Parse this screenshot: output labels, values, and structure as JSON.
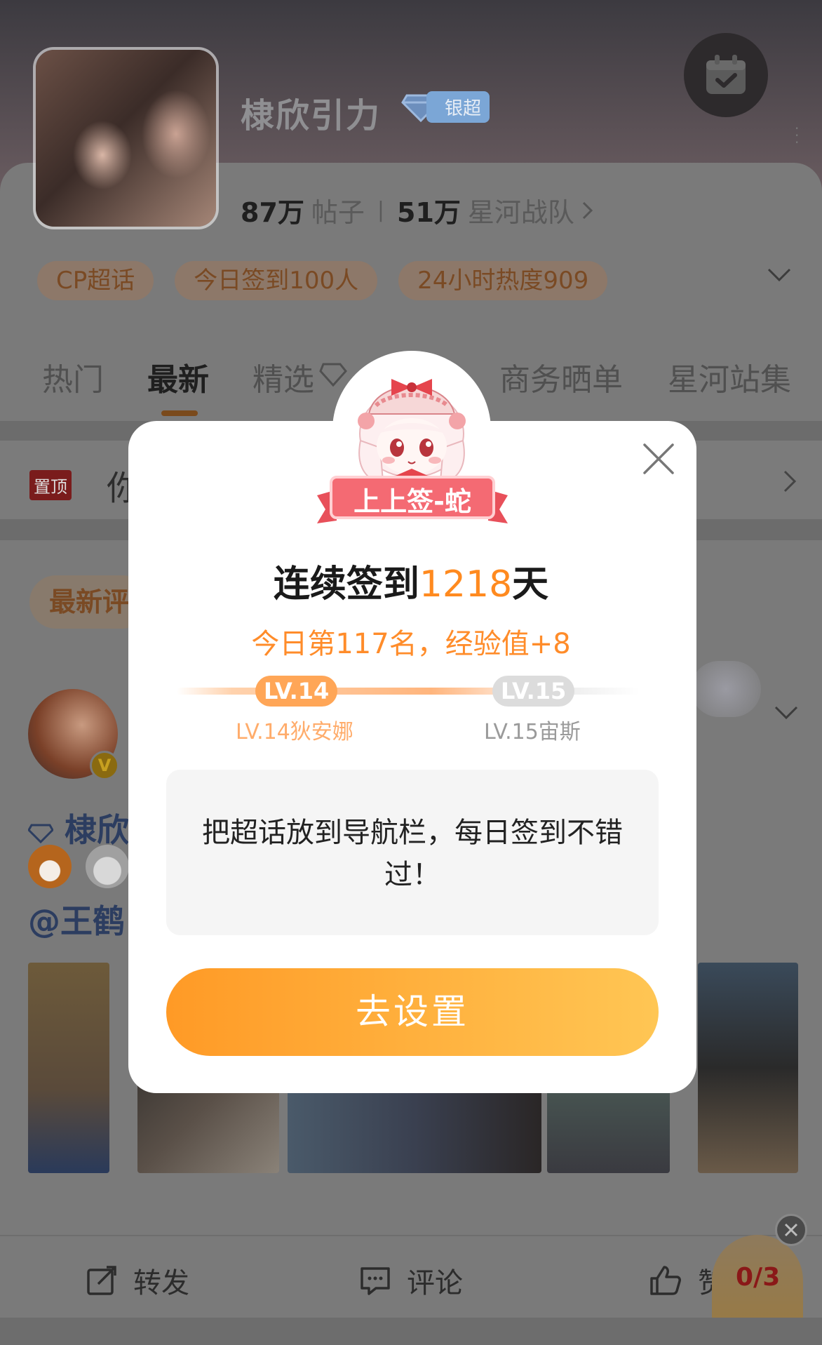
{
  "header": {
    "title": "棣欣引力",
    "badge": "银超",
    "posts_count": "87万",
    "posts_label": "帖子",
    "members_count": "51万",
    "members_label": "星河战队"
  },
  "tags": [
    "CP超话",
    "今日签到100人",
    "24小时热度909"
  ],
  "tabs": [
    {
      "label": "热门"
    },
    {
      "label": "最新",
      "active": true
    },
    {
      "label": "精选"
    },
    {
      "label": "商务晒单"
    },
    {
      "label": "星河站集"
    }
  ],
  "pinned": {
    "badge": "置顶",
    "text": "你                                                    超..."
  },
  "sort_label": "最新评",
  "post": {
    "author_line": "棣欣",
    "mention_line": "@王鹤"
  },
  "actions": {
    "repost": "转发",
    "comment": "评论",
    "like": "赞"
  },
  "task_progress": "0/3",
  "modal": {
    "ribbon_text": "上上签-蛇",
    "title_prefix": "连续签到",
    "streak_days": "1218",
    "title_suffix": "天",
    "subtitle": "今日第117名，经验值+8",
    "current_level": "LV.14",
    "current_level_name": "LV.14狄安娜",
    "next_level": "LV.15",
    "next_level_name": "LV.15宙斯",
    "tip": "把超话放到导航栏，每日签到不错过！",
    "button": "去设置"
  },
  "colors": {
    "accent": "#ff8a1f",
    "button_start": "#ff9a26",
    "button_end": "#ffc654",
    "level_pill": "#ffa657"
  }
}
